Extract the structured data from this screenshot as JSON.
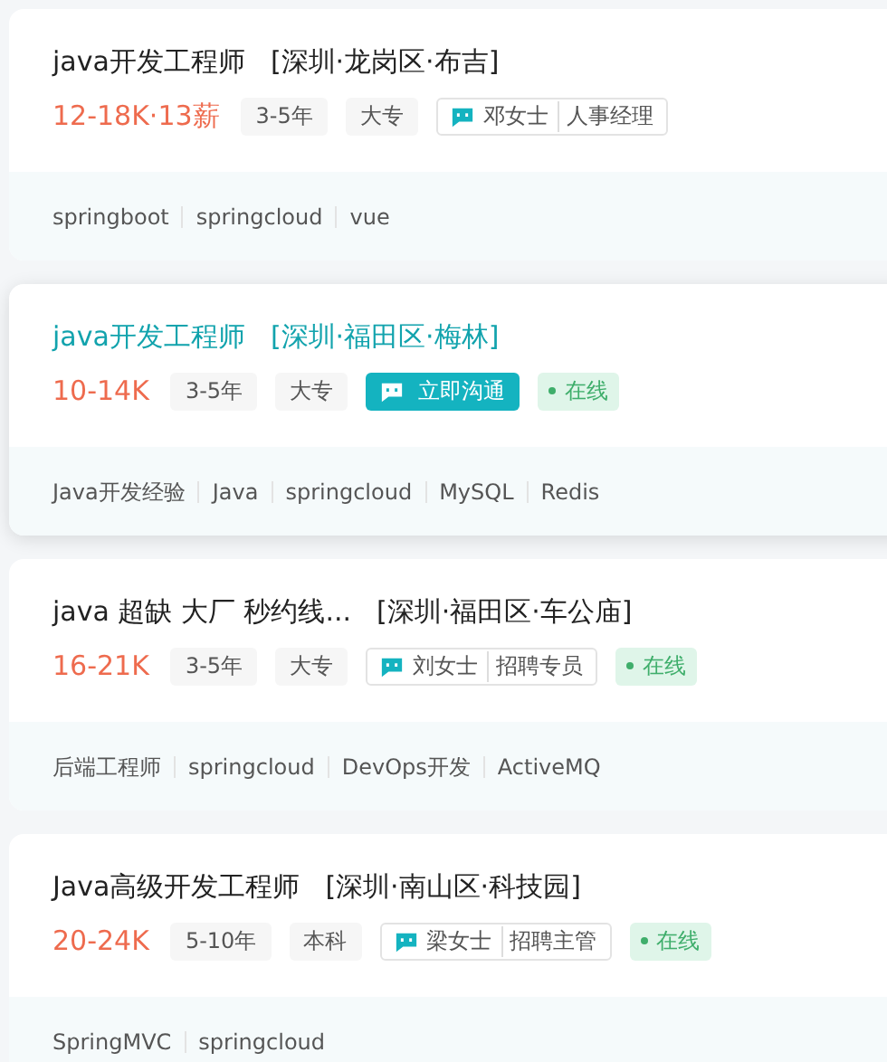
{
  "jobs": [
    {
      "title": "java开发工程师",
      "location": "[深圳·龙岗区·布吉]",
      "hovered": false,
      "salary": "12-18K·13薪",
      "tags": [
        "3-5年",
        "大专"
      ],
      "contact": {
        "kind": "recruiter",
        "name": "邓女士",
        "role": "人事经理"
      },
      "online": false,
      "skills": [
        "springboot",
        "springcloud",
        "vue"
      ]
    },
    {
      "title": "java开发工程师",
      "location": "[深圳·福田区·梅林]",
      "hovered": true,
      "salary": "10-14K",
      "tags": [
        "3-5年",
        "大专"
      ],
      "contact": {
        "kind": "chat",
        "label": "立即沟通"
      },
      "online": true,
      "online_label": "在线",
      "skills": [
        "Java开发经验",
        "Java",
        "springcloud",
        "MySQL",
        "Redis"
      ]
    },
    {
      "title": "java 超缺 大厂 秒约线...",
      "location": "[深圳·福田区·车公庙]",
      "hovered": false,
      "salary": "16-21K",
      "tags": [
        "3-5年",
        "大专"
      ],
      "contact": {
        "kind": "recruiter",
        "name": "刘女士",
        "role": "招聘专员"
      },
      "online": true,
      "online_label": "在线",
      "skills": [
        "后端工程师",
        "springcloud",
        "DevOps开发",
        "ActiveMQ"
      ]
    },
    {
      "title": "Java高级开发工程师",
      "location": "[深圳·南山区·科技园]",
      "hovered": false,
      "salary": "20-24K",
      "tags": [
        "5-10年",
        "本科"
      ],
      "contact": {
        "kind": "recruiter",
        "name": "梁女士",
        "role": "招聘主管"
      },
      "online": true,
      "online_label": "在线",
      "skills": [
        "SpringMVC",
        "springcloud"
      ]
    }
  ]
}
